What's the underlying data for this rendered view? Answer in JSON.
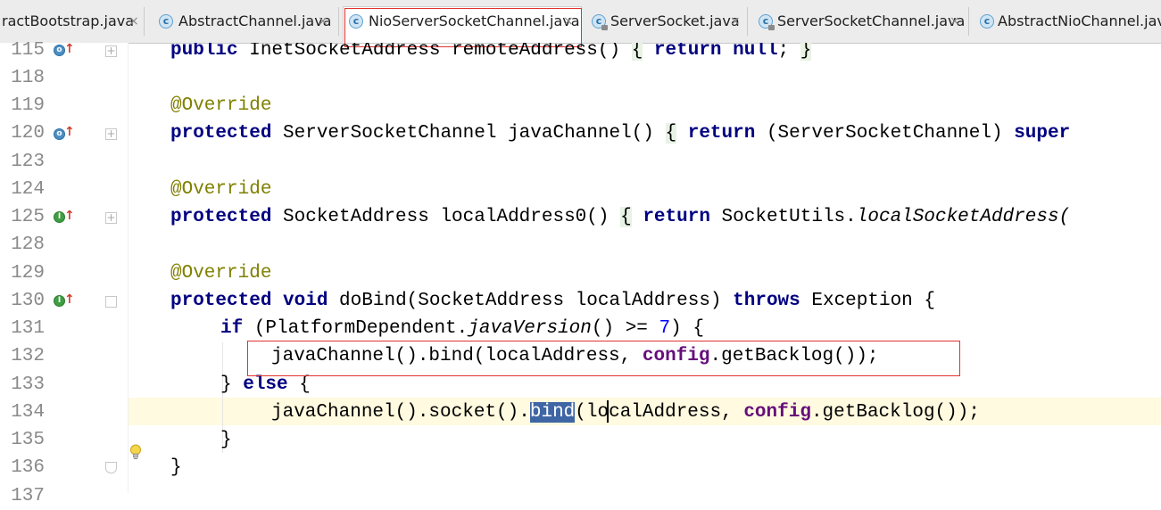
{
  "tabs": [
    {
      "label": "ractBootstrap.java",
      "lock": false,
      "active": false
    },
    {
      "label": "AbstractChannel.java",
      "lock": false,
      "active": false
    },
    {
      "label": "NioServerSocketChannel.java",
      "lock": false,
      "active": true
    },
    {
      "label": "ServerSocket.java",
      "lock": true,
      "active": false
    },
    {
      "label": "ServerSocketChannel.java",
      "lock": true,
      "active": false
    },
    {
      "label": "AbstractNioChannel.java",
      "lock": false,
      "active": false
    }
  ],
  "tab_close_glyph": "×",
  "tab_icon_letter": "c",
  "gutter": {
    "line_numbers": [
      "115",
      "118",
      "119",
      "120",
      "123",
      "124",
      "125",
      "128",
      "129",
      "130",
      "131",
      "132",
      "133",
      "134",
      "135",
      "136",
      "137"
    ],
    "markers": [
      {
        "line": "115",
        "icon": "override-icon",
        "letter": "o"
      },
      {
        "line": "120",
        "icon": "override-icon",
        "letter": "o"
      },
      {
        "line": "125",
        "icon": "implement-icon",
        "letter": "I"
      },
      {
        "line": "130",
        "icon": "implement-icon",
        "letter": "I"
      }
    ]
  },
  "code": {
    "l115": {
      "kw1": "public",
      "t1": " InetSocketAddress remoteAddress() ",
      "b1": "{",
      "t2": " ",
      "kw2": "return",
      "t3": " ",
      "kw3": "null",
      "t4": "; ",
      "b2": "}"
    },
    "l119": {
      "an": "@Override"
    },
    "l120": {
      "kw1": "protected",
      "t1": " ServerSocketChannel javaChannel() ",
      "b1": "{",
      "t2": " ",
      "kw2": "return",
      "t3": " (ServerSocketChannel) ",
      "kw3": "super"
    },
    "l124": {
      "an": "@Override"
    },
    "l125": {
      "kw1": "protected",
      "t1": " SocketAddress localAddress0() ",
      "b1": "{",
      "t2": " ",
      "kw2": "return",
      "t3": " SocketUtils.",
      "st": "localSocketAddress("
    },
    "l129": {
      "an": "@Override"
    },
    "l130": {
      "kw1": "protected",
      "t1": " ",
      "kw2": "void",
      "t2": " doBind(SocketAddress localAddress) ",
      "kw3": "throws",
      "t3": " Exception {"
    },
    "l131": {
      "kw1": "if",
      "t1": " (PlatformDependent.",
      "st": "javaVersion",
      "t2": "() >= ",
      "num": "7",
      "t3": ") {"
    },
    "l132": {
      "t1": "javaChannel().bind(localAddress, ",
      "fd": "config",
      "t2": ".getBacklog());"
    },
    "l133": {
      "t1": "} ",
      "kw1": "else",
      "t2": " {"
    },
    "l134": {
      "t1": "javaChannel().socket().",
      "sel": "bind",
      "t2": "(localAddress, ",
      "fd": "config",
      "t3": ".getBacklog());"
    },
    "l135": {
      "t1": "}"
    },
    "l136": {
      "t1": "}"
    }
  },
  "colors": {
    "keyword": "#000080",
    "annotation": "#808000",
    "field": "#660e7a",
    "number": "#0000ff",
    "selection": "#3f66a4",
    "current_line": "#fffae0",
    "highlight_box": "#e0332e"
  }
}
